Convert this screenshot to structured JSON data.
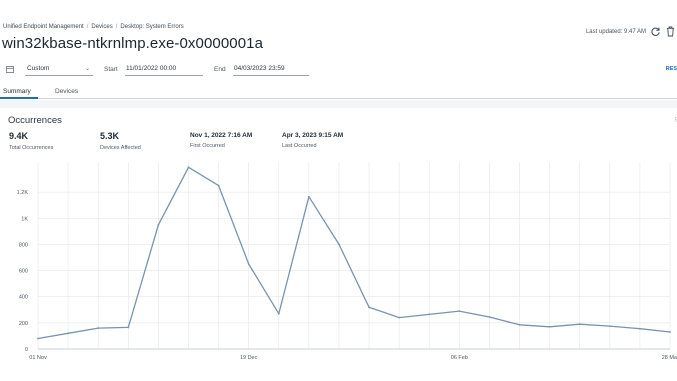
{
  "breadcrumb": {
    "items": [
      "Unified Endpoint Management",
      "Devices",
      "Desktop: System Errors"
    ],
    "separator": "/"
  },
  "page": {
    "title": "win32kbase-ntkrnlmp.exe-0x0000001a"
  },
  "header": {
    "last_updated": "Last updated: 9:47 AM"
  },
  "icons": {
    "calendar": "calendar-icon",
    "refresh": "refresh-icon",
    "trash": "trash-icon",
    "dropdown": "chevron-down-icon"
  },
  "filters": {
    "range_value": "Custom",
    "start_label": "Start",
    "start_value": "11/01/2022 00:00",
    "end_label": "End",
    "end_value": "04/03/2023 23:59",
    "reset_label": "RES"
  },
  "tabs": [
    {
      "label": "Summary",
      "active": true
    },
    {
      "label": "Devices",
      "active": false
    }
  ],
  "section": {
    "title": "Occurrences",
    "more": "⁝"
  },
  "stats": [
    {
      "value": "9.4K",
      "label": "Total Occurrences"
    },
    {
      "value": "5.3K",
      "label": "Devices Affected"
    },
    {
      "value": "Nov 1, 2022 7:16 AM",
      "label": "First Occurred"
    },
    {
      "value": "Apr 3, 2023 9:15 AM",
      "label": "Last Occurred"
    }
  ],
  "colors": {
    "accent": "#1d6fae",
    "line": "#7a93ad",
    "grid": "#e3e7eb"
  },
  "chart_data": {
    "type": "line",
    "ylim": [
      0,
      1400
    ],
    "yticks": [
      0,
      200,
      400,
      600,
      800,
      1000,
      1200
    ],
    "ytick_labels": [
      "0",
      "200",
      "400",
      "600",
      "800",
      "1K",
      "1.2K"
    ],
    "xtick_labels": [
      {
        "label": "01 Nov",
        "index": 0
      },
      {
        "label": "19 Dec",
        "index": 7
      },
      {
        "label": "06 Feb",
        "index": 14
      },
      {
        "label": "28 Ma",
        "index": 21
      }
    ],
    "x": [
      "01 Nov",
      "08 Nov",
      "15 Nov",
      "22 Nov",
      "29 Nov",
      "06 Dec",
      "13 Dec",
      "19 Dec",
      "26 Dec",
      "02 Jan",
      "09 Jan",
      "16 Jan",
      "23 Jan",
      "30 Jan",
      "06 Feb",
      "13 Feb",
      "20 Feb",
      "27 Feb",
      "06 Mar",
      "13 Mar",
      "20 Mar",
      "28 Mar"
    ],
    "values": [
      80,
      120,
      160,
      165,
      950,
      1390,
      1250,
      650,
      270,
      1165,
      800,
      320,
      240,
      265,
      290,
      245,
      185,
      170,
      190,
      175,
      155,
      130
    ],
    "grid": true
  }
}
